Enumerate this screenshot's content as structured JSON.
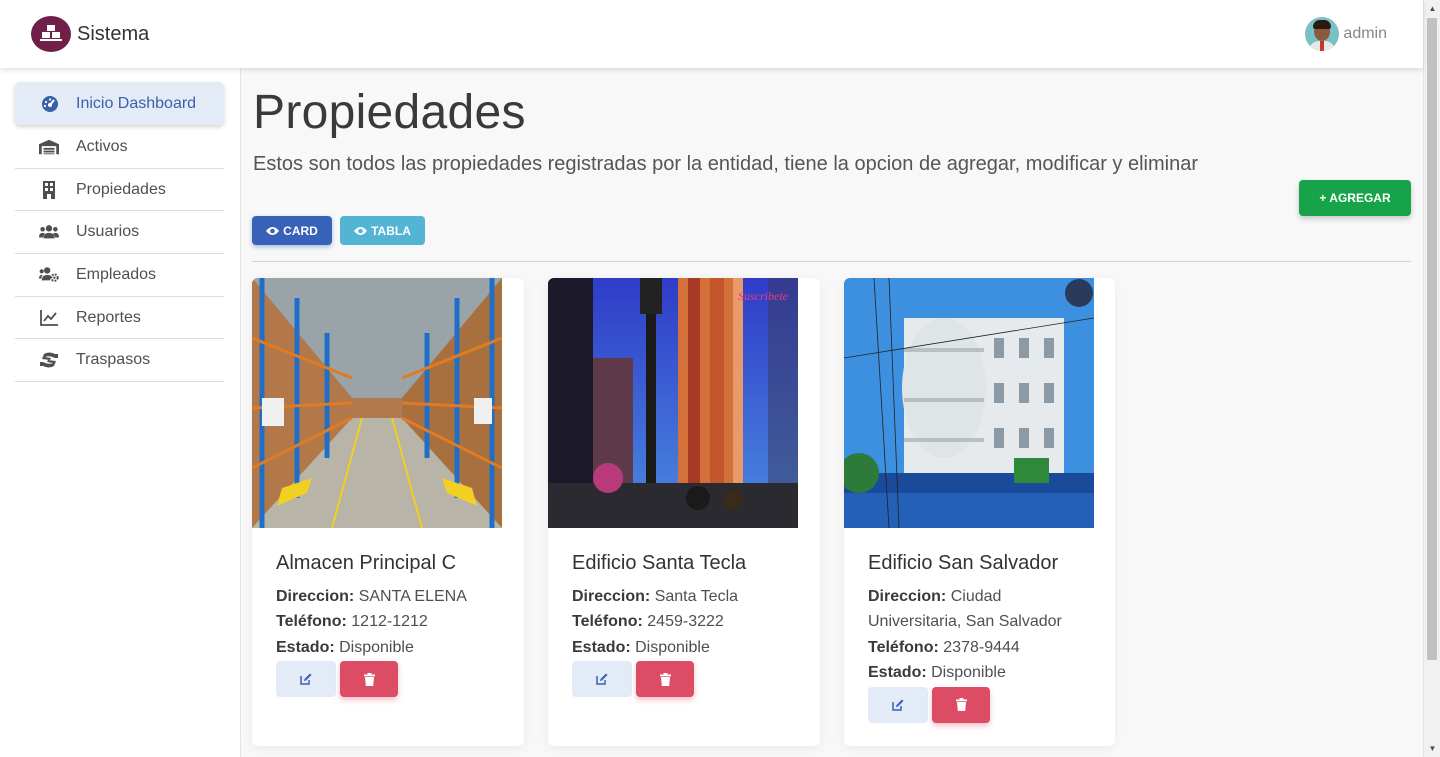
{
  "app": {
    "brand_name": "Sistema",
    "user_name": "admin"
  },
  "sidebar": {
    "items": [
      {
        "label": "Inicio Dashboard",
        "icon": "gauge-icon",
        "active": true
      },
      {
        "label": "Activos",
        "icon": "warehouse-icon",
        "active": false
      },
      {
        "label": "Propiedades",
        "icon": "building-icon",
        "active": false
      },
      {
        "label": "Usuarios",
        "icon": "users-icon",
        "active": false
      },
      {
        "label": "Empleados",
        "icon": "users-gear-icon",
        "active": false
      },
      {
        "label": "Reportes",
        "icon": "chart-line-icon",
        "active": false
      },
      {
        "label": "Traspasos",
        "icon": "hand-money-icon",
        "active": false
      }
    ]
  },
  "main": {
    "title": "Propiedades",
    "description": "Estos son todos las propiedades registradas por la entidad, tiene la opcion de agregar, modificar y eliminar",
    "add_button": "+ AGREGAR",
    "view_card_label": "CARD",
    "view_table_label": "TABLA"
  },
  "labels": {
    "direccion": "Direccion:",
    "telefono": "Teléfono:",
    "estado": "Estado:"
  },
  "properties": [
    {
      "name": "Almacen Principal C",
      "direccion": "SANTA ELENA",
      "telefono": "1212-1212",
      "estado": "Disponible"
    },
    {
      "name": "Edificio Santa Tecla",
      "direccion": "Santa Tecla",
      "telefono": "2459-3222",
      "estado": "Disponible"
    },
    {
      "name": "Edificio San Salvador",
      "direccion": "Ciudad Universitaria, San Salvador",
      "telefono": "2378-9444",
      "estado": "Disponible"
    }
  ],
  "images": {
    "img2_watermark": "Suscribete"
  },
  "colors": {
    "primary": "#3861b8",
    "info": "#54b4d3",
    "success": "#16a34a",
    "danger": "#dc4c64",
    "brand": "#6f1f48",
    "active_bg": "#e3ebf7"
  }
}
